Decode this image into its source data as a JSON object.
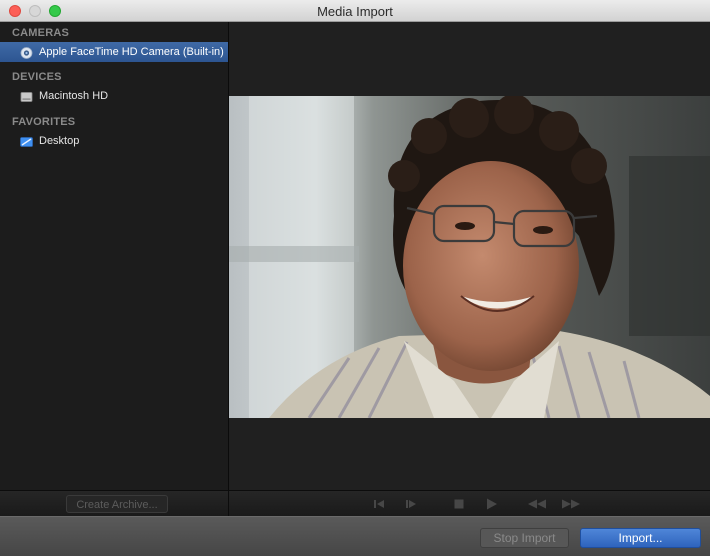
{
  "window": {
    "title": "Media Import"
  },
  "sidebar": {
    "sections": [
      {
        "heading": "CAMERAS",
        "items": [
          {
            "label": "Apple FaceTime HD Camera (Built-in)",
            "icon": "camera-icon",
            "selected": true
          }
        ]
      },
      {
        "heading": "DEVICES",
        "items": [
          {
            "label": "Macintosh HD",
            "icon": "hard-drive-icon",
            "selected": false
          }
        ]
      },
      {
        "heading": "FAVORITES",
        "items": [
          {
            "label": "Desktop",
            "icon": "desktop-folder-icon",
            "selected": false
          }
        ]
      }
    ],
    "create_archive_label": "Create Archive..."
  },
  "transport": {
    "controls": [
      "previous-frame-icon",
      "next-frame-icon",
      "stop-icon",
      "play-icon",
      "rewind-icon",
      "fast-forward-icon"
    ]
  },
  "footer": {
    "stop_import_label": "Stop Import",
    "import_label": "Import..."
  },
  "colors": {
    "selection": "#3a64a0",
    "import_button": "#3a70cc",
    "panel_bg": "#1c1c1c"
  }
}
